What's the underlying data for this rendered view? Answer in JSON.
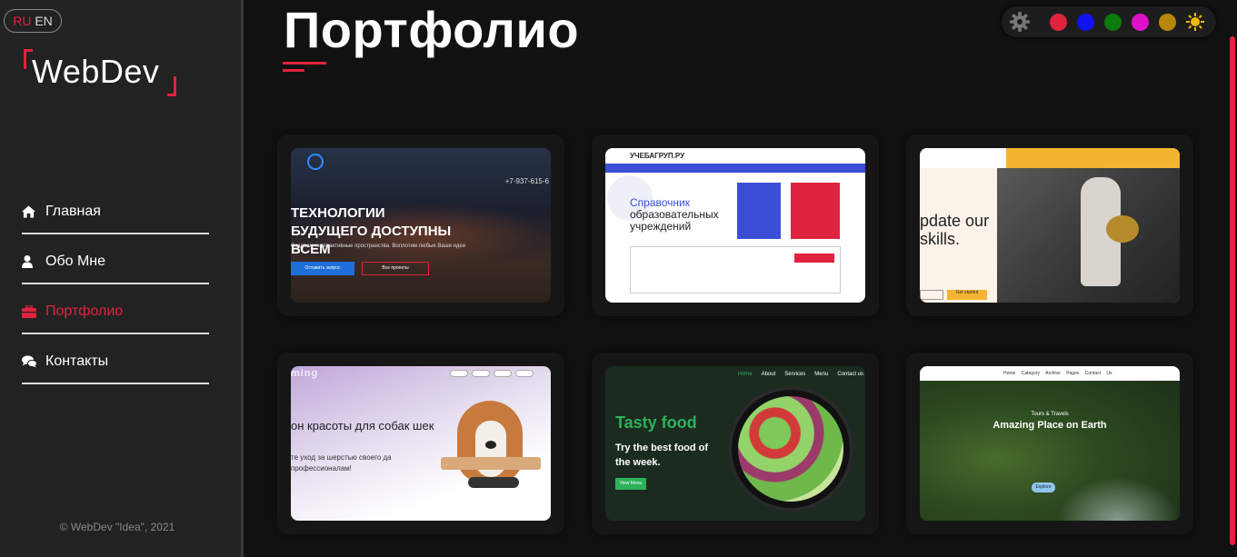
{
  "lang": {
    "ru": "RU",
    "en": "EN"
  },
  "logo": {
    "text": "WebDev"
  },
  "nav": {
    "items": [
      {
        "label": "Главная",
        "icon": "home-icon"
      },
      {
        "label": "Обо Мне",
        "icon": "user-icon"
      },
      {
        "label": "Портфолио",
        "icon": "briefcase-icon"
      },
      {
        "label": "Контакты",
        "icon": "comments-icon"
      }
    ],
    "active": "Портфолио"
  },
  "copyright": "© WebDev \"Idea\", 2021",
  "page": {
    "title": "Портфолио"
  },
  "palette": {
    "colors": [
      "#e0233e",
      "#1212f0",
      "#0c7a0c",
      "#e010c8",
      "#b8860b"
    ],
    "theme_icon": "sun-icon",
    "settings_icon": "gear-icon"
  },
  "projects": [
    {
      "heading": "ТЕХНОЛОГИИ БУДУЩЕГО ДОСТУПНЫ ВСЕМ",
      "subtitle": "Создаем интерактивные пространства. Воплотим любые Ваши идеи",
      "phone": "+7-937-615-6",
      "button_primary": "Оставить запрос",
      "button_secondary": "Все проекты"
    },
    {
      "logo": "УЧЕБАГРУП.РУ",
      "heading_blue": "Справочник",
      "heading_dark": "образовательных учреждений"
    },
    {
      "heading": "pdate our skills.",
      "button_primary": "Get started"
    },
    {
      "brand": "ming",
      "heading": "он красоты для собак шек",
      "text": "те уход за шерстью своего да профессионалам!"
    },
    {
      "heading": "Tasty food",
      "subtitle": "Try the best food of the week.",
      "button": "View Menu",
      "nav": [
        "Home",
        "About",
        "Services",
        "Menu",
        "Contact us"
      ]
    },
    {
      "nav": "Home Category Archive Pages Contact Us",
      "eyebrow": "Tours & Travels",
      "heading": "Amazing Place on Earth",
      "button": "Explore"
    }
  ]
}
